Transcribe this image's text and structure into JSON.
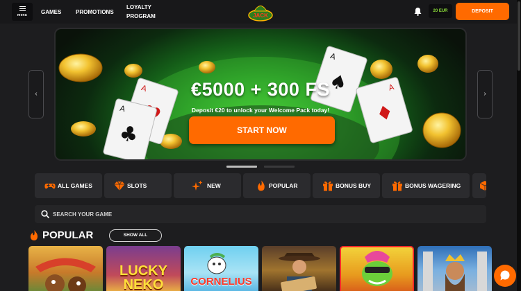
{
  "header": {
    "menu_label": "menu",
    "nav": [
      "GAMES",
      "PROMOTIONS",
      "LOYALTY",
      "PROGRAM"
    ],
    "logo_text": "JACK",
    "balance": "20 EUR",
    "deposit_label": "DEPOSIT"
  },
  "hero": {
    "title": "€5000 + 300 FS",
    "subtitle": "Deposit €20 to unlock your Welcome Pack today!",
    "cta": "START NOW"
  },
  "categories": [
    {
      "label": "ALL GAMES",
      "icon": "gamepad-icon"
    },
    {
      "label": "SLOTS",
      "icon": "diamond-icon"
    },
    {
      "label": "NEW",
      "icon": "sparkle-icon"
    },
    {
      "label": "POPULAR",
      "icon": "flame-icon"
    },
    {
      "label": "BONUS BUY",
      "icon": "gift-icon"
    },
    {
      "label": "BONUS WAGERING",
      "icon": "gift-icon"
    }
  ],
  "search": {
    "placeholder": "SEARCH YOUR GAME"
  },
  "popular": {
    "title": "POPULAR",
    "show_all": "SHOW ALL",
    "tiles": [
      {
        "label": ""
      },
      {
        "label": "LUCKY NEKO"
      },
      {
        "label": "CORNELIUS"
      },
      {
        "label": ""
      },
      {
        "label": ""
      },
      {
        "label": ""
      }
    ]
  },
  "colors": {
    "accent": "#ff6a00",
    "balance_green": "#8ee03a",
    "background": "#1d1d1f"
  }
}
